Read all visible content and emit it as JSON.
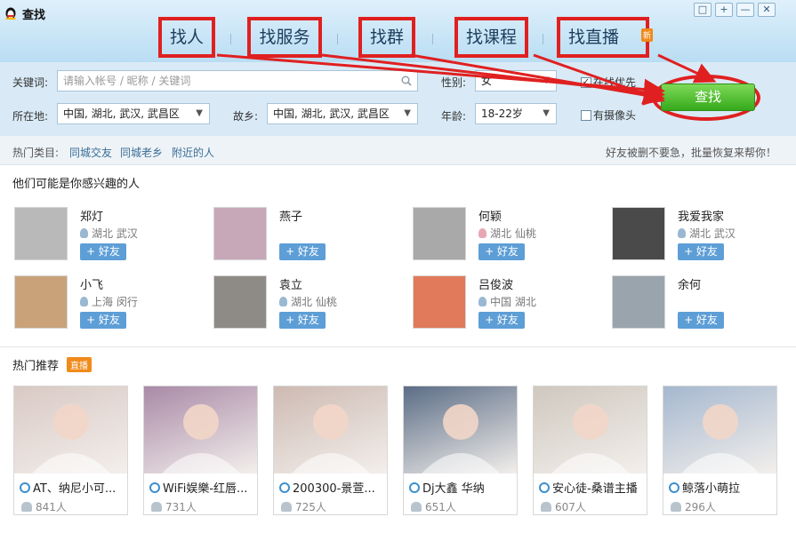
{
  "window": {
    "title": "查找",
    "controls": [
      "□",
      "+",
      "—",
      "✕"
    ]
  },
  "tabs": [
    {
      "label": "找人"
    },
    {
      "label": "找服务"
    },
    {
      "label": "找群"
    },
    {
      "label": "找课程"
    },
    {
      "label": "找直播",
      "badge": "新"
    }
  ],
  "search": {
    "keyword_label": "关键词:",
    "keyword_placeholder": "请输入帐号 / 昵称 / 关键词",
    "gender_label": "性别:",
    "gender_value": "女",
    "online_label": "在线优先",
    "online_checked": true,
    "location_label": "所在地:",
    "location_value": "中国, 湖北, 武汉, 武昌区",
    "hometown_label": "故乡:",
    "hometown_value": "中国, 湖北, 武汉, 武昌区",
    "age_label": "年龄:",
    "age_value": "18-22岁",
    "camera_label": "有摄像头",
    "camera_checked": false,
    "find_button": "查找"
  },
  "hot": {
    "title": "热门类目:",
    "links": [
      "同城交友",
      "同城老乡",
      "附近的人"
    ],
    "promo": "好友被删不要急，批量恢复来帮你！"
  },
  "people_section": {
    "title": "他们可能是你感兴趣的人",
    "add_label": "+ 好友",
    "people": [
      {
        "name": "郑灯",
        "location": "湖北 武汉",
        "gender": "male",
        "color": "#b9b9b9"
      },
      {
        "name": "燕子",
        "location": "",
        "gender": "female",
        "color": "#c7a8b8"
      },
      {
        "name": "何颖",
        "location": "湖北 仙桃",
        "gender": "female",
        "color": "#a9a9a9"
      },
      {
        "name": "我爱我家",
        "location": "湖北 武汉",
        "gender": "male",
        "color": "#4a4a4a"
      },
      {
        "name": "小飞",
        "location": "上海 闵行",
        "gender": "male",
        "color": "#c9a27a"
      },
      {
        "name": "袁立",
        "location": "湖北 仙桃",
        "gender": "male",
        "color": "#8e8a86"
      },
      {
        "name": "吕俊波",
        "location": "中国 湖北",
        "gender": "male",
        "color": "#e07a5a"
      },
      {
        "name": "余何",
        "location": "",
        "gender": "male",
        "color": "#9aa4ad"
      }
    ]
  },
  "live_section": {
    "title": "热门推荐",
    "badge": "直播",
    "cards": [
      {
        "title": "AT、纳尼小可...",
        "viewers": "841人",
        "color": "#d9c9c4"
      },
      {
        "title": "WiFi娱樂-红唇...",
        "viewers": "731人",
        "color": "#a98aa7"
      },
      {
        "title": "200300-景萱...",
        "viewers": "725人",
        "color": "#cdbab2"
      },
      {
        "title": "Dj大鑫 华纳",
        "viewers": "651人",
        "color": "#5b6d86"
      },
      {
        "title": "安心徒-桑谱主播",
        "viewers": "607人",
        "color": "#cfc8bf"
      },
      {
        "title": "鲸落小萌拉",
        "viewers": "296人",
        "color": "#a5b8cf"
      }
    ]
  }
}
